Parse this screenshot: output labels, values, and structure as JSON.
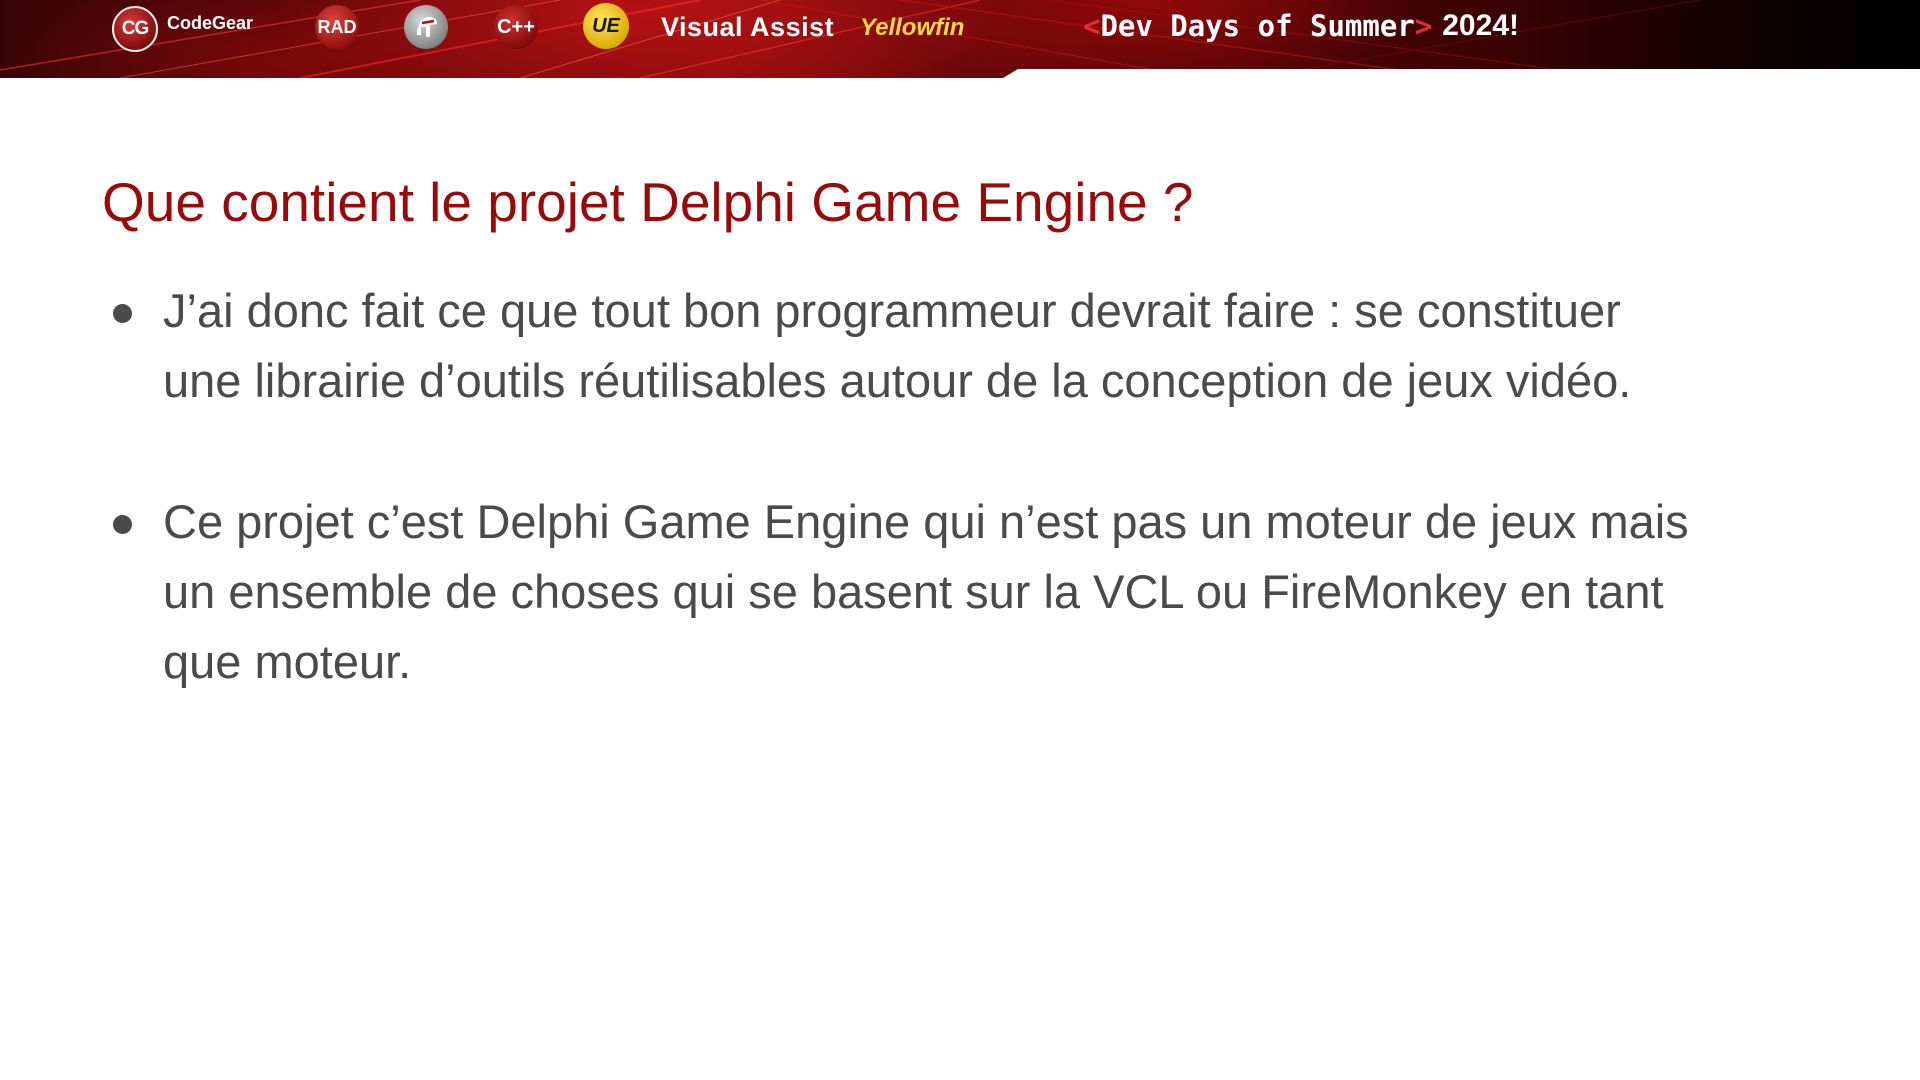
{
  "banner": {
    "colors": {
      "dark_red": "#5c0709",
      "bright_red": "#be1414",
      "black": "#000000"
    },
    "logos": [
      {
        "icon": "codegear-logo-icon",
        "text": "CG",
        "label": "CodeGear"
      },
      {
        "icon": "rad-logo-icon",
        "label": "RAD"
      },
      {
        "icon": "delphi-helmet-logo-icon"
      },
      {
        "icon": "cpp-builder-logo-icon",
        "label": "C++"
      },
      {
        "icon": "unreal-engine-logo-icon",
        "label": "UE"
      },
      {
        "icon": "visual-assist-logo-icon",
        "label": "Visual Assist"
      },
      {
        "icon": "yellowfin-logo-icon",
        "label": "Yellowfin"
      }
    ],
    "event": {
      "open_bracket": "<",
      "name": "Dev Days of Summer",
      "close_bracket": ">",
      "year": "2024!"
    }
  },
  "slide": {
    "title": "Que contient le projet Delphi Game Engine ?",
    "title_color": "#9b0a0a",
    "text_color": "#4a4a4a",
    "bullets": [
      {
        "lines": [
          "J’ai donc fait ce que tout bon programmeur devrait faire : se constituer",
          "une librairie d’outils réutilisables autour de la conception de jeux vidéo."
        ]
      },
      {
        "lines": [
          "Ce projet c’est Delphi Game Engine qui n’est pas un moteur de jeux mais",
          "un ensemble de choses qui se basent sur la VCL ou FireMonkey en tant",
          "que moteur."
        ]
      }
    ]
  }
}
